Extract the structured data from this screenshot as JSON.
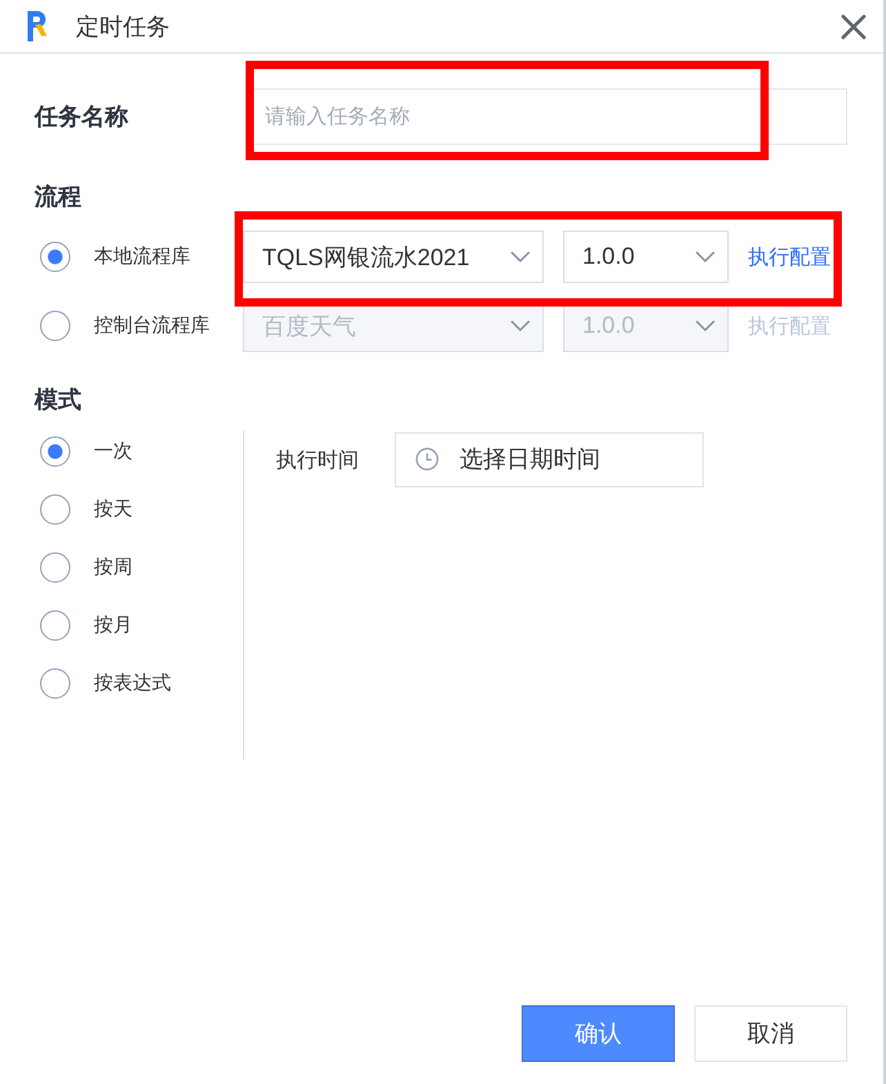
{
  "window": {
    "title": "定时任务"
  },
  "task_name": {
    "label": "任务名称",
    "placeholder": "请输入任务名称",
    "highlighted": true
  },
  "flow": {
    "heading": "流程",
    "sources": [
      {
        "label": "本地流程库",
        "selected": true,
        "disabled": false,
        "highlighted": true,
        "process": "TQLS网银流水2021",
        "version": "1.0.0",
        "link": "执行配置"
      },
      {
        "label": "控制台流程库",
        "selected": false,
        "disabled": true,
        "highlighted": false,
        "process": "百度天气",
        "version": "1.0.0",
        "link": "执行配置"
      }
    ]
  },
  "mode": {
    "heading": "模式",
    "options": [
      {
        "label": "一次",
        "selected": true
      },
      {
        "label": "按天",
        "selected": false
      },
      {
        "label": "按周",
        "selected": false
      },
      {
        "label": "按月",
        "selected": false
      },
      {
        "label": "按表达式",
        "selected": false
      }
    ],
    "schedule": {
      "label": "执行时间",
      "placeholder": "选择日期时间"
    }
  },
  "buttons": [
    {
      "label": "确认",
      "kind": "primary"
    },
    {
      "label": "取消",
      "kind": "secondary"
    }
  ]
}
